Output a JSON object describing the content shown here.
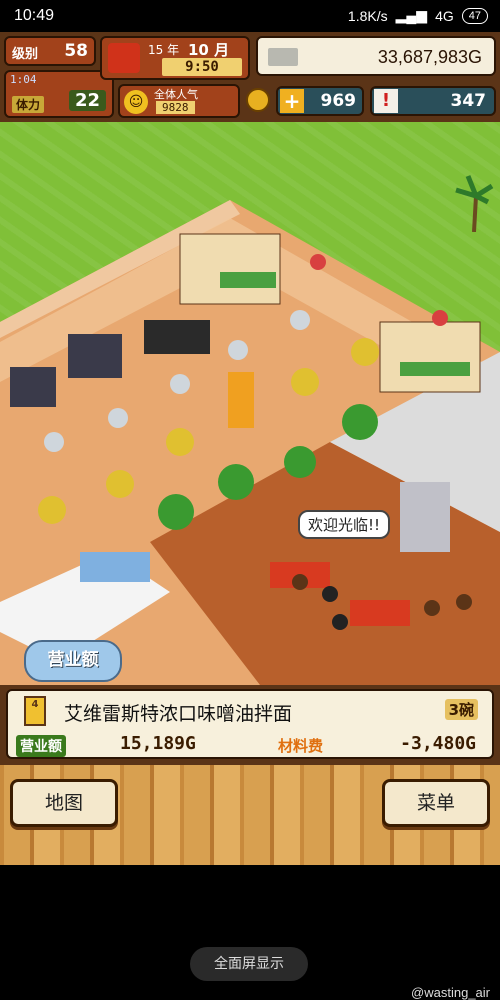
{
  "status_bar": {
    "time": "10:49",
    "network_speed": "1.8K/s",
    "network_type": "4G",
    "battery": "47"
  },
  "hud": {
    "level_label": "级别",
    "level_value": "58",
    "stamina_timer": "1:04",
    "stamina_label": "体力",
    "stamina_value": "22",
    "year": "15 年",
    "month": "10 月",
    "clock": "9:50",
    "money": "33,687,983G",
    "popularity_label": "全体人气",
    "popularity_value": "9828",
    "points": "969",
    "research": "347"
  },
  "scene": {
    "speech_bubble": "欢迎光临!!",
    "sales_badge": "营业额"
  },
  "order": {
    "number": "4",
    "dish_name": "艾维雷斯特浓口味噌油拌面",
    "count": "3碗",
    "sales_label": "营业额",
    "sales_value": "15,189G",
    "cost_label": "材料费",
    "cost_value": "-3,480G"
  },
  "buttons": {
    "map": "地图",
    "menu": "菜单"
  },
  "system": {
    "fullscreen": "全面屏显示",
    "watermark": "@wasting_air"
  },
  "colors": {
    "hud_frame": "#5b3417",
    "grass": "#80c038",
    "panel_bg": "#f7f0dc"
  }
}
